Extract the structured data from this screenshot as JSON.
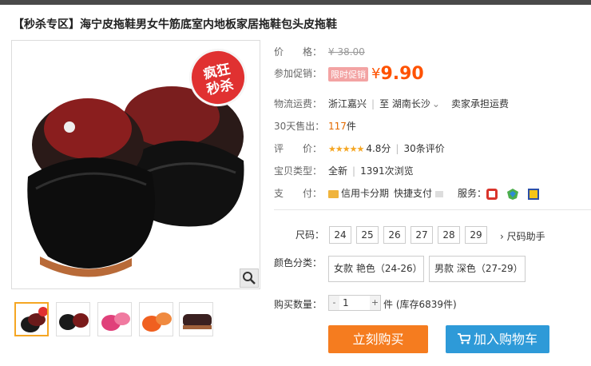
{
  "title": "【秒杀专区】海宁皮拖鞋男女牛筋底室内地板家居拖鞋包头皮拖鞋",
  "badge": {
    "line1": "疯狂",
    "line2": "秒杀"
  },
  "price": {
    "label": "价　　格：",
    "original": "¥ 38.00"
  },
  "promo": {
    "label": "参加促销：",
    "tag": "限时促销",
    "currency": "¥",
    "value": "9.90"
  },
  "shipping": {
    "label": "物流运费：",
    "from": "浙江嘉兴",
    "sep": "|",
    "to": "至  湖南长沙",
    "arrow": "⌄",
    "fee": "卖家承担运费"
  },
  "sold": {
    "label": "30天售出：",
    "count": "117",
    "unit": "件"
  },
  "rating": {
    "label": "评　　价：",
    "stars": "★★★★★",
    "score": "4.8分",
    "sep": "|",
    "reviews": "30条评价"
  },
  "type": {
    "label": "宝贝类型：",
    "value": "全新",
    "sep": "|",
    "views": "1391次浏览"
  },
  "payment": {
    "label": "支　　付：",
    "card": "信用卡分期",
    "quick": "快捷支付",
    "service_label": "服务："
  },
  "sizes": {
    "label": "尺码：",
    "options": [
      "24",
      "25",
      "26",
      "27",
      "28",
      "29"
    ],
    "helper": "尺码助手"
  },
  "colors": {
    "label": "颜色分类：",
    "options": [
      "女款 艳色（24-26）",
      "男款 深色（27-29）"
    ]
  },
  "quantity": {
    "label": "购买数量：",
    "value": "1",
    "minus": "-",
    "plus": "+",
    "stock": "件 (库存6839件)"
  },
  "buttons": {
    "buy": "立刻购买",
    "cart": "加入购物车"
  },
  "colors_theme": {
    "accent": "#ff5200",
    "buy": "#f57c1f",
    "cart": "#2e9ad8",
    "badge": "#e03131"
  }
}
